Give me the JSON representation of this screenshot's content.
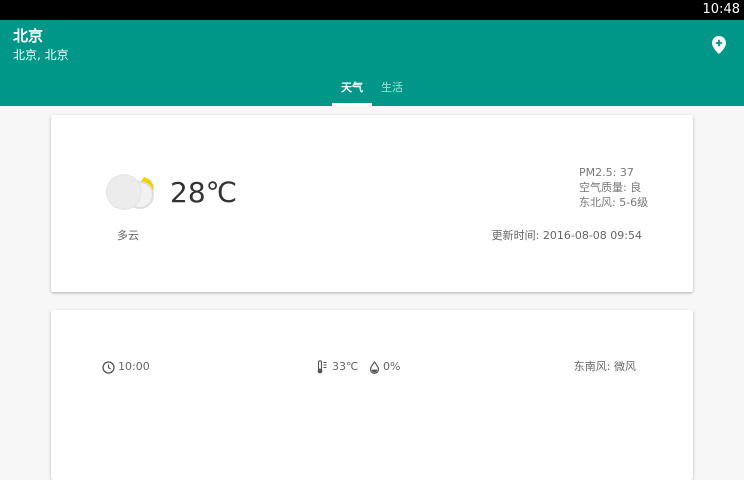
{
  "status_bar": {
    "time": "10:48"
  },
  "header": {
    "title": "北京",
    "subtitle": "北京, 北京",
    "location_icon": "location-pin-icon",
    "color": "#009688"
  },
  "tabs": [
    {
      "label": "天气",
      "selected": true
    },
    {
      "label": "生活",
      "selected": false
    }
  ],
  "current": {
    "icon": "cloudy-sun-icon",
    "temperature": "28℃",
    "condition": "多云",
    "pm25": "PM2.5: 37",
    "air_quality": "空气质量: 良",
    "wind": "东北风: 5-6级",
    "update_time": "更新时间: 2016-08-08 09:54"
  },
  "hourly": [
    {
      "time": "10:00",
      "temperature": "33℃",
      "rain_chance": "0%",
      "wind": "东南风: 微风"
    }
  ]
}
